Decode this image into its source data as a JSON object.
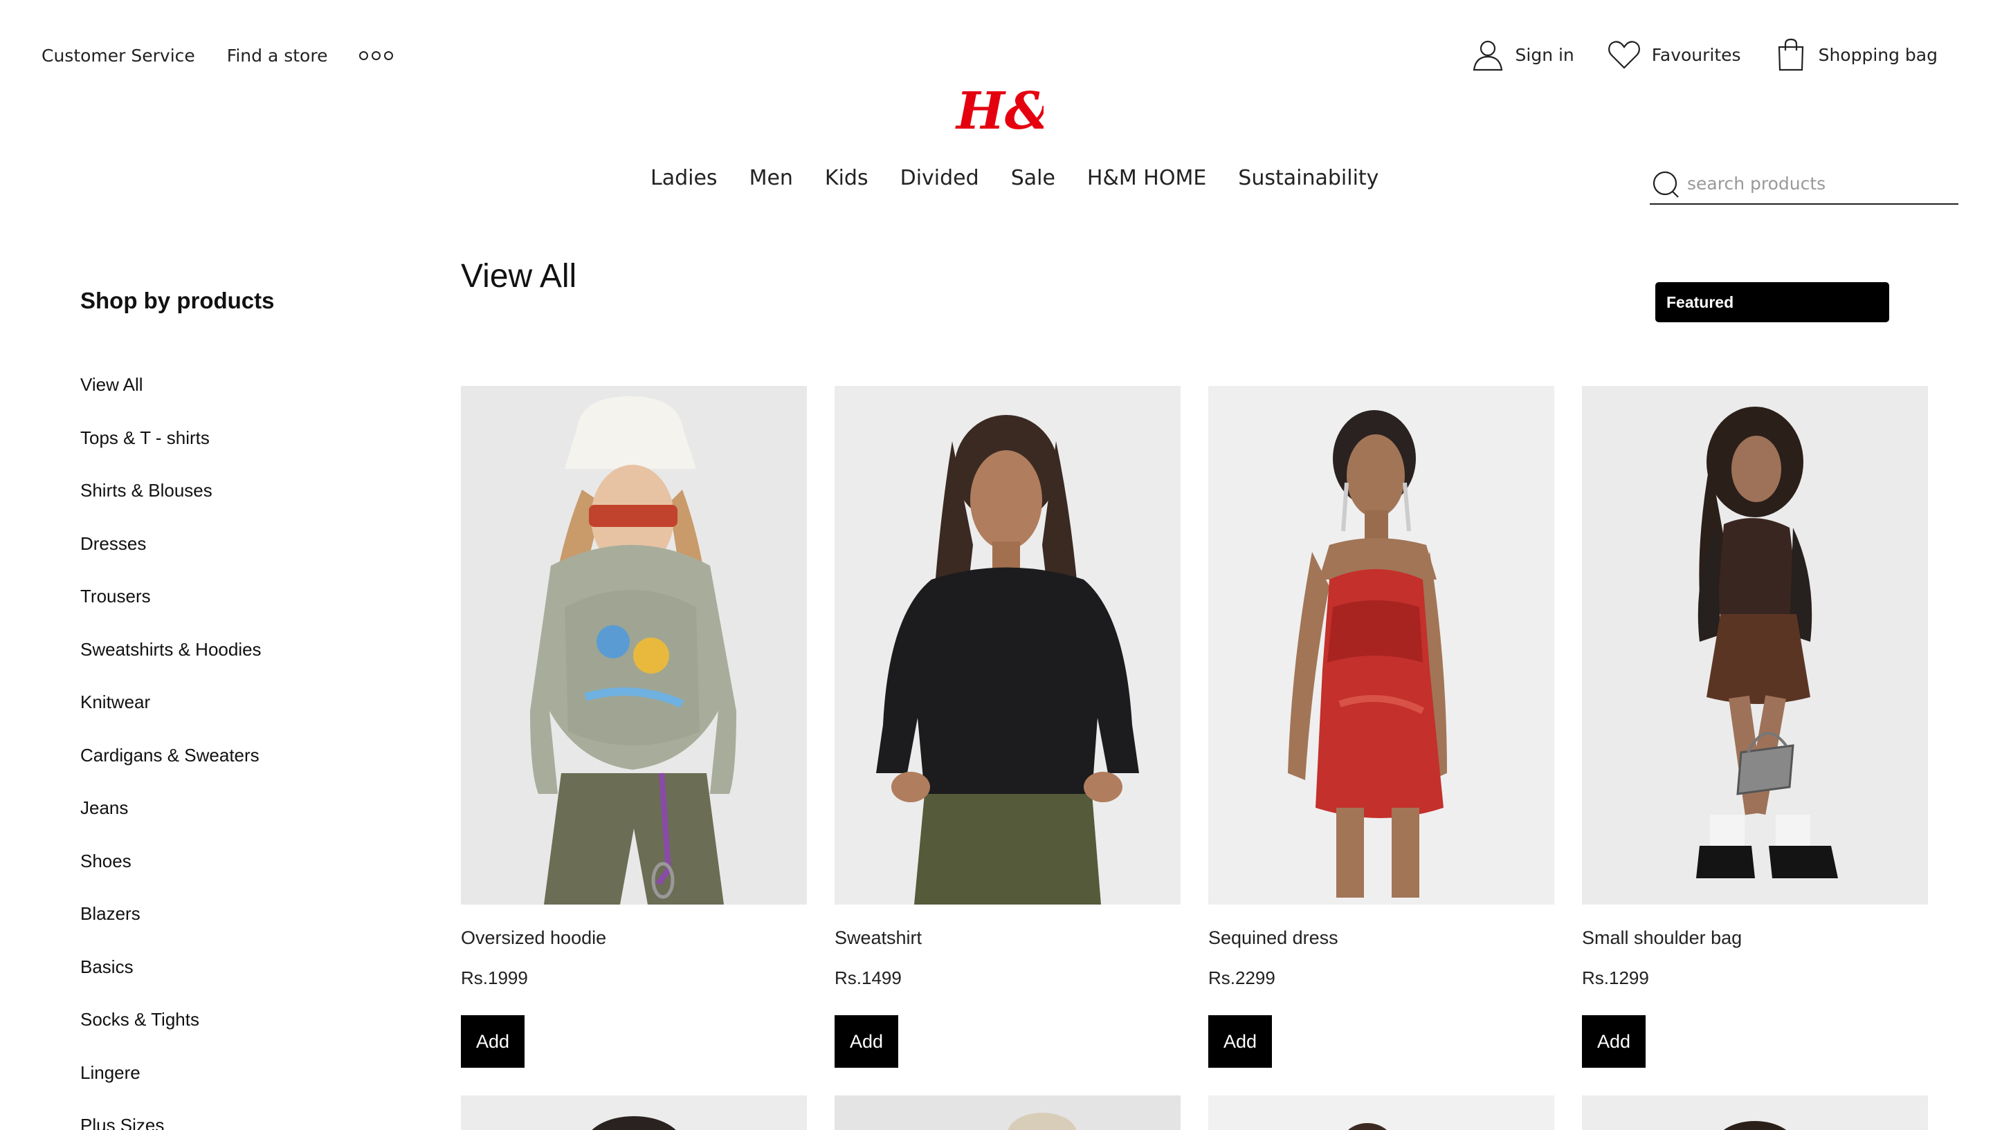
{
  "header": {
    "utility_left": [
      "Customer Service",
      "Find a store"
    ],
    "more_icon": "more-dots-icon",
    "sign_in": "Sign in",
    "favourites": "Favourites",
    "shopping_bag": "Shopping bag",
    "brand": "H&M",
    "brand_color": "#e50010"
  },
  "nav": [
    "Ladies",
    "Men",
    "Kids",
    "Divided",
    "Sale",
    "H&M HOME",
    "Sustainability"
  ],
  "search": {
    "placeholder": "search products"
  },
  "sidebar": {
    "title": "Shop by products",
    "items": [
      "View All",
      "Tops & T - shirts",
      "Shirts & Blouses",
      "Dresses",
      "Trousers",
      "Sweatshirts & Hoodies",
      "Knitwear",
      "Cardigans & Sweaters",
      "Jeans",
      "Shoes",
      "Blazers",
      "Basics",
      "Socks & Tights",
      "Lingere",
      "Plus Sizes"
    ]
  },
  "main": {
    "title": "View All",
    "sort": "Featured",
    "add_label": "Add",
    "products": [
      {
        "name": "Oversized hoodie",
        "price": "Rs.1999"
      },
      {
        "name": "Sweatshirt",
        "price": "Rs.1499"
      },
      {
        "name": "Sequined dress",
        "price": "Rs.2299"
      },
      {
        "name": "Small shoulder bag",
        "price": "Rs.1299"
      }
    ]
  }
}
